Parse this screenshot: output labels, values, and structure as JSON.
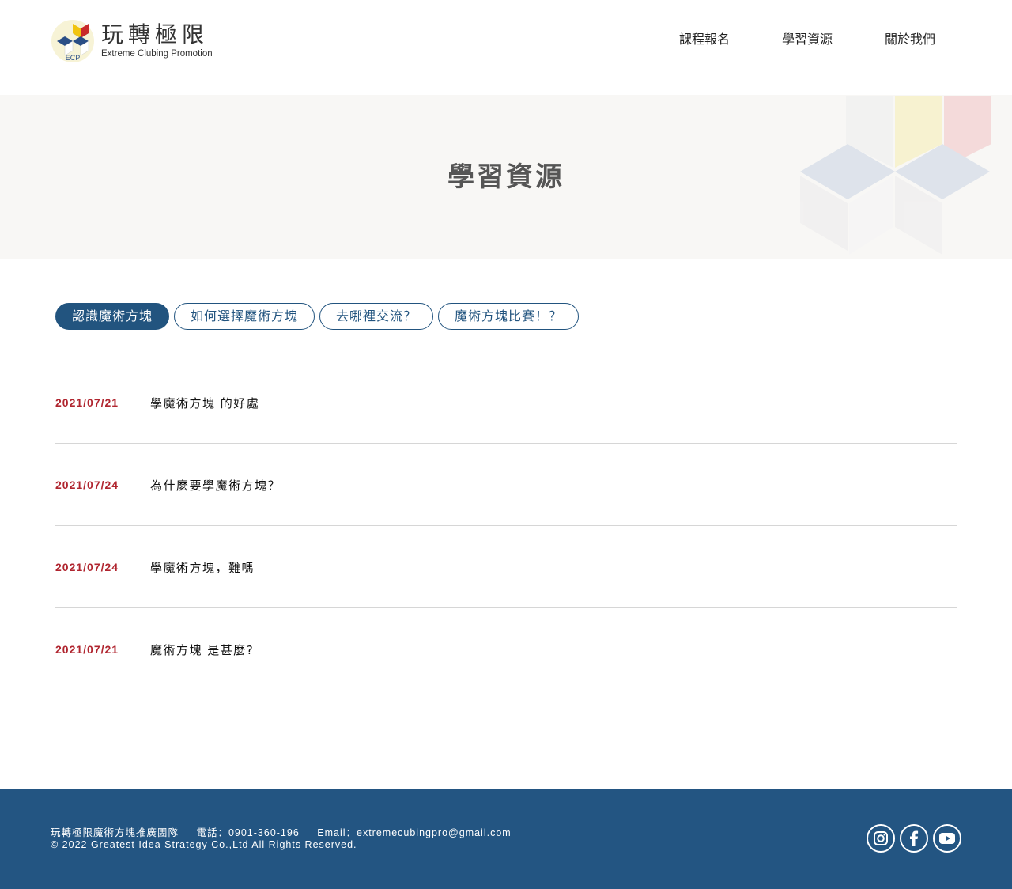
{
  "brand": {
    "name": "玩轉極限",
    "tagline": "Extreme Clubing Promotion",
    "mark_text": "ECP"
  },
  "nav": {
    "items": [
      {
        "label": "課程報名"
      },
      {
        "label": "學習資源"
      },
      {
        "label": "關於我們"
      }
    ]
  },
  "banner": {
    "title": "學習資源"
  },
  "tabs": [
    {
      "label": "認識魔術方塊",
      "active": true
    },
    {
      "label": "如何選擇魔術方塊",
      "active": false
    },
    {
      "label": "去哪裡交流？",
      "active": false
    },
    {
      "label": "魔術方塊比賽！？",
      "active": false
    }
  ],
  "articles": [
    {
      "date": "2021/07/21",
      "title": "學魔術方塊 的好處"
    },
    {
      "date": "2021/07/24",
      "title": "為什麼要學魔術方塊？"
    },
    {
      "date": "2021/07/24",
      "title": "學魔術方塊，難嗎"
    },
    {
      "date": "2021/07/21",
      "title": "魔術方塊 是甚麼?"
    }
  ],
  "footer": {
    "contact": "玩轉極限魔術方塊推廣團隊 ｜ 電話：0901-360-196 ｜ Email：extremecubingpro@gmail.com",
    "copyright": "© 2022 Greatest Idea Strategy Co.,Ltd All Rights Reserved.",
    "socials": [
      {
        "icon": "instagram-icon"
      },
      {
        "icon": "facebook-icon"
      },
      {
        "icon": "youtube-icon"
      }
    ]
  },
  "colors": {
    "primary": "#22547f",
    "footer_bg": "#235582",
    "date": "#b0252f",
    "banner_bg": "#f8f7f5"
  }
}
